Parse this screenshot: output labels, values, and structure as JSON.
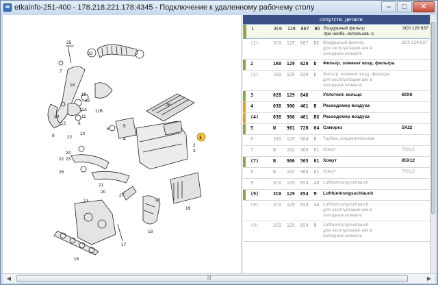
{
  "window": {
    "title": "etkainfo-251-400 - 178.218.221.178:4345 - Подключение к удаленному рабочему столу",
    "controls": {
      "minimize": "–",
      "maximize": "□",
      "close": "✕"
    }
  },
  "diagram": {
    "labels": [
      "1",
      "2",
      "3",
      "4",
      "5",
      "6",
      "7",
      "8",
      "9",
      "10",
      "11",
      "11A",
      "11B",
      "12",
      "13",
      "14",
      "15",
      "16",
      "17",
      "18",
      "19",
      "20",
      "21",
      "22",
      "23",
      "24",
      "25",
      "26",
      "27",
      "28",
      "29"
    ],
    "callout": "1"
  },
  "parts_table": {
    "header": "сопутств. детали",
    "rows": [
      {
        "pos": "1",
        "number": "3C0  129  607  BD",
        "desc": [
          "Воздушный фильтр",
          "при необх. использов. с:"
        ],
        "note": "3C0 129 637",
        "style": "selected",
        "marker": "#8aa84a"
      },
      {
        "pos": "(1)",
        "number": "3C0  129  607  BE",
        "desc": [
          "Воздушный фильтр",
          "для эксплуатации а/м в",
          "холодном климате"
        ],
        "note": "3C0 129 637",
        "style": "grey",
        "marker": ""
      },
      {
        "pos": "2",
        "number": "1K0  129  620  D",
        "desc": [
          "Фильтр. элемент возд. фильтра"
        ],
        "note": "",
        "style": "bold",
        "marker": "#8aa84a"
      },
      {
        "pos": "(2)",
        "number": "1K0  129  620  E",
        "desc": [
          "Фильтр. элемент возд. фильтра",
          "для эксплуатации а/м в",
          "холодном климате"
        ],
        "note": "",
        "style": "grey",
        "marker": ""
      },
      {
        "pos": "3",
        "number": "028  129  646",
        "desc": [
          "Уплотнит. кольцо"
        ],
        "note": "69X6",
        "style": "bold",
        "marker": "#8aa84a"
      },
      {
        "pos": "4",
        "number": "038  906  461  B",
        "desc": [
          "Расходомер воздуха"
        ],
        "note": "",
        "style": "bold",
        "marker": "#e0a020"
      },
      {
        "pos": "(4)",
        "number": "038  906  461  BX",
        "desc": [
          "Расходомер воздуха"
        ],
        "note": "",
        "style": "bold",
        "marker": "#e0a020"
      },
      {
        "pos": "5",
        "number": "N    901  720  04",
        "desc": [
          "Саморез"
        ],
        "note": "5X22",
        "style": "bold",
        "marker": "#8aa84a"
      },
      {
        "pos": "6",
        "number": "1K0  129  684  B",
        "desc": [
          "Трубка, соединительная"
        ],
        "note": "",
        "style": "grey",
        "marker": ""
      },
      {
        "pos": "7",
        "number": "N    102  960  01",
        "desc": [
          "Хомут"
        ],
        "note": "75X12",
        "style": "grey",
        "marker": ""
      },
      {
        "pos": "(7)",
        "number": "N    906  565  01",
        "desc": [
          "Хомут"
        ],
        "note": "85X12",
        "style": "bold",
        "marker": "#8aa84a"
      },
      {
        "pos": "8",
        "number": "N    102  960  01",
        "desc": [
          "Хомут"
        ],
        "note": "75X12",
        "style": "grey",
        "marker": ""
      },
      {
        "pos": "9",
        "number": "3C0  129  654  AD",
        "desc": [
          "Luftfuehrungsschlauch"
        ],
        "note": "",
        "style": "grey",
        "marker": ""
      },
      {
        "pos": "(9)",
        "number": "3C0  129  654  M",
        "desc": [
          "Luftfuehrungsschlauch"
        ],
        "note": "",
        "style": "bold",
        "marker": "#8aa84a"
      },
      {
        "pos": "(9)",
        "number": "3C0  129  654  AG",
        "desc": [
          "Luftfuehrungsschlauch",
          "для эксплуатации а/м в",
          "холодном климате"
        ],
        "note": "",
        "style": "grey",
        "marker": ""
      },
      {
        "pos": "(9)",
        "number": "3C0  129  654  N",
        "desc": [
          "Luftfuehrungsschlauch",
          "для эксплуатации а/м в",
          "холодном климате"
        ],
        "note": "",
        "style": "grey",
        "marker": ""
      }
    ]
  },
  "scrollbar": {
    "grip": "|||"
  }
}
